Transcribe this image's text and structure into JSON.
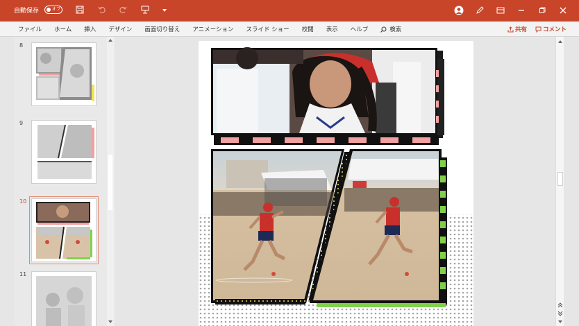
{
  "titlebar": {
    "autosave_label": "自動保存",
    "autosave_state": "オフ",
    "background": "#c8452a"
  },
  "ribbon": {
    "tabs": [
      "ファイル",
      "ホーム",
      "挿入",
      "デザイン",
      "画面切り替え",
      "アニメーション",
      "スライド ショー",
      "校閲",
      "表示",
      "ヘルプ"
    ],
    "search_label": "検索",
    "share_label": "共有",
    "comment_label": "コメント"
  },
  "thumbnails": [
    {
      "number": "8",
      "active": false
    },
    {
      "number": "9",
      "active": false
    },
    {
      "number": "10",
      "active": true
    },
    {
      "number": "11",
      "active": false
    }
  ],
  "colors": {
    "accent": "#c8452a",
    "pink": "#f2a0a0",
    "green": "#7fd14a",
    "yellow": "#f2e35a"
  }
}
